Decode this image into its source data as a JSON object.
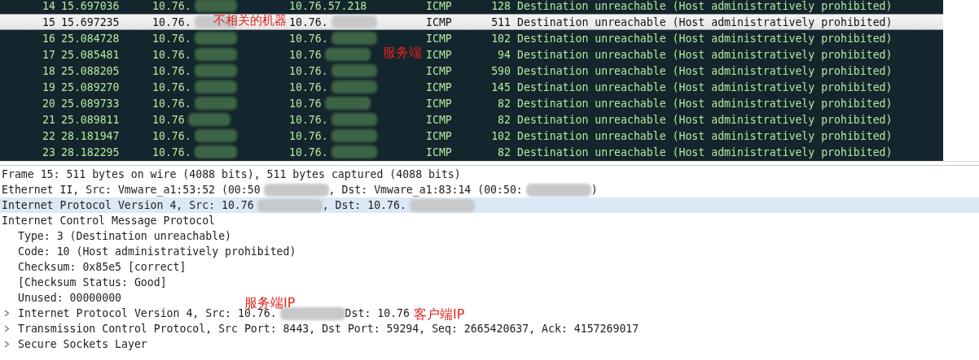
{
  "packets": [
    {
      "no": "14",
      "time": "15.697036",
      "source": "10.76.",
      "source_redacted": true,
      "destination": "10.76.57.218",
      "destination_redacted": false,
      "protocol": "ICMP",
      "length": "128",
      "info": "Destination unreachable (Host administratively prohibited)",
      "selected": false
    },
    {
      "no": "15",
      "time": "15.697235",
      "source": "10.76.",
      "source_redacted": true,
      "destination": "10.76.",
      "destination_redacted": true,
      "protocol": "ICMP",
      "length": "511",
      "info": "Destination unreachable (Host administratively prohibited)",
      "selected": true
    },
    {
      "no": "16",
      "time": "25.084728",
      "source": "10.76.",
      "source_redacted": true,
      "destination": "10.76.",
      "destination_redacted": true,
      "protocol": "ICMP",
      "length": "102",
      "info": "Destination unreachable (Host administratively prohibited)",
      "selected": false
    },
    {
      "no": "17",
      "time": "25.085481",
      "source": "10.76.",
      "source_redacted": true,
      "destination": "10.76",
      "destination_redacted": true,
      "protocol": "ICMP",
      "length": "94",
      "info": "Destination unreachable (Host administratively prohibited)",
      "selected": false
    },
    {
      "no": "18",
      "time": "25.088205",
      "source": "10.76.",
      "source_redacted": true,
      "destination": "10.76.",
      "destination_redacted": true,
      "protocol": "ICMP",
      "length": "590",
      "info": "Destination unreachable (Host administratively prohibited)",
      "selected": false
    },
    {
      "no": "19",
      "time": "25.089270",
      "source": "10.76.",
      "source_redacted": true,
      "destination": "10.76.",
      "destination_redacted": true,
      "protocol": "ICMP",
      "length": "145",
      "info": "Destination unreachable (Host administratively prohibited)",
      "selected": false
    },
    {
      "no": "20",
      "time": "25.089733",
      "source": "10.76.",
      "source_redacted": true,
      "destination": "10.76",
      "destination_redacted": true,
      "protocol": "ICMP",
      "length": "82",
      "info": "Destination unreachable (Host administratively prohibited)",
      "selected": false
    },
    {
      "no": "21",
      "time": "25.089811",
      "source": "10.76",
      "source_redacted": true,
      "destination": "10.76.",
      "destination_redacted": true,
      "protocol": "ICMP",
      "length": "82",
      "info": "Destination unreachable (Host administratively prohibited)",
      "selected": false
    },
    {
      "no": "22",
      "time": "28.181947",
      "source": "10.76.",
      "source_redacted": true,
      "destination": "10.76.",
      "destination_redacted": true,
      "protocol": "ICMP",
      "length": "102",
      "info": "Destination unreachable (Host administratively prohibited)",
      "selected": false
    },
    {
      "no": "23",
      "time": "28.182295",
      "source": "10.76.",
      "source_redacted": true,
      "destination": "10.76.",
      "destination_redacted": true,
      "protocol": "ICMP",
      "length": "82",
      "info": "Destination unreachable (Host administratively prohibited)",
      "selected": false
    }
  ],
  "details": [
    {
      "segments": [
        {
          "kind": "text",
          "text": "Frame 15: 511 bytes on wire (4088 bits), 511 bytes captured (4088 bits)"
        }
      ],
      "selected": false
    },
    {
      "segments": [
        {
          "kind": "text",
          "text": "Ethernet II, Src: Vmware_a1:53:52 (00:50"
        },
        {
          "kind": "redacted"
        },
        {
          "kind": "text",
          "text": ", Dst: Vmware_a1:83:14 (00:50:"
        },
        {
          "kind": "redacted"
        },
        {
          "kind": "text",
          "text": ")"
        }
      ],
      "selected": false
    },
    {
      "segments": [
        {
          "kind": "text",
          "text": "Internet Protocol Version 4, Src: 10.76"
        },
        {
          "kind": "redacted"
        },
        {
          "kind": "text",
          "text": ", Dst: 10.76."
        },
        {
          "kind": "redacted"
        }
      ],
      "selected": true
    },
    {
      "segments": [
        {
          "kind": "text",
          "text": "Internet Control Message Protocol"
        }
      ],
      "selected": false,
      "children": [
        {
          "segments": [
            {
              "kind": "text",
              "text": "Type: 3 (Destination unreachable)"
            }
          ],
          "selected": false
        },
        {
          "segments": [
            {
              "kind": "text",
              "text": "Code: 10 (Host administratively prohibited)"
            }
          ],
          "selected": false
        },
        {
          "segments": [
            {
              "kind": "text",
              "text": "Checksum: 0x85e5 [correct]"
            }
          ],
          "selected": false
        },
        {
          "segments": [
            {
              "kind": "text",
              "text": "[Checksum Status: Good]"
            }
          ],
          "selected": false
        },
        {
          "segments": [
            {
              "kind": "text",
              "text": "Unused: 00000000"
            }
          ],
          "selected": false
        },
        {
          "segments": [
            {
              "kind": "text",
              "text": "Internet Protocol Version 4, Src: 10.76."
            },
            {
              "kind": "redacted"
            },
            {
              "kind": "text",
              "text": "Dst: 10.76"
            }
          ],
          "selected": false,
          "expanded": false
        },
        {
          "segments": [
            {
              "kind": "text",
              "text": "Transmission Control Protocol, Src Port: 8443, Dst Port: 59294, Seq: 2665420637, Ack: 4157269017"
            }
          ],
          "selected": false,
          "expanded": false
        },
        {
          "segments": [
            {
              "kind": "text",
              "text": "Secure Sockets Layer"
            }
          ],
          "selected": false,
          "expanded": false
        }
      ]
    }
  ],
  "annotations": [
    {
      "text": "不相关的机器"
    },
    {
      "text": "服务端"
    },
    {
      "text": "服务端IP"
    },
    {
      "text": "客户端IP"
    }
  ]
}
